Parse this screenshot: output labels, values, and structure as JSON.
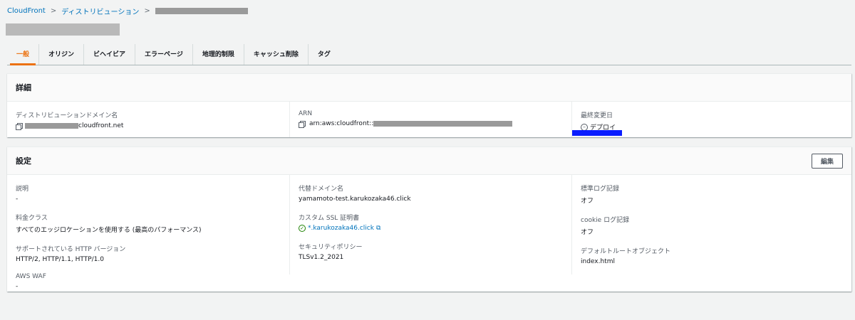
{
  "breadcrumb": {
    "items": [
      "CloudFront",
      "ディストリビューション"
    ]
  },
  "tabs": [
    {
      "label": "一般",
      "active": true
    },
    {
      "label": "オリジン",
      "active": false
    },
    {
      "label": "ビヘイビア",
      "active": false
    },
    {
      "label": "エラーページ",
      "active": false
    },
    {
      "label": "地理的制限",
      "active": false
    },
    {
      "label": "キャッシュ削除",
      "active": false
    },
    {
      "label": "タグ",
      "active": false
    }
  ],
  "details": {
    "title": "詳細",
    "domain_label": "ディストリビューションドメイン名",
    "domain_value": "cloudfront.net",
    "arn_label": "ARN",
    "arn_value": "arn:aws:cloudfront::",
    "modified_label": "最終変更日",
    "modified_value": "デプロイ"
  },
  "settings": {
    "title": "設定",
    "edit_label": "編集",
    "description_label": "説明",
    "description_value": "-",
    "price_class_label": "料金クラス",
    "price_class_value": "すべてのエッジロケーションを使用する (最高のパフォーマンス)",
    "http_label": "サポートされている HTTP バージョン",
    "http_value": "HTTP/2, HTTP/1.1, HTTP/1.0",
    "waf_label": "AWS WAF",
    "waf_value": "-",
    "alt_domain_label": "代替ドメイン名",
    "alt_domain_value": "yamamoto-test.karukozaka46.click",
    "ssl_label": "カスタム SSL 証明書",
    "ssl_value": "*.karukozaka46.click",
    "security_policy_label": "セキュリティポリシー",
    "security_policy_value": "TLSv1.2_2021",
    "std_log_label": "標準ログ記録",
    "std_log_value": "オフ",
    "cookie_log_label": "cookie ログ記録",
    "cookie_log_value": "オフ",
    "default_root_label": "デフォルトルートオブジェクト",
    "default_root_value": "index.html"
  },
  "colors": {
    "accent": "#ec7211",
    "link": "#0073bb",
    "success": "#1d8102"
  }
}
